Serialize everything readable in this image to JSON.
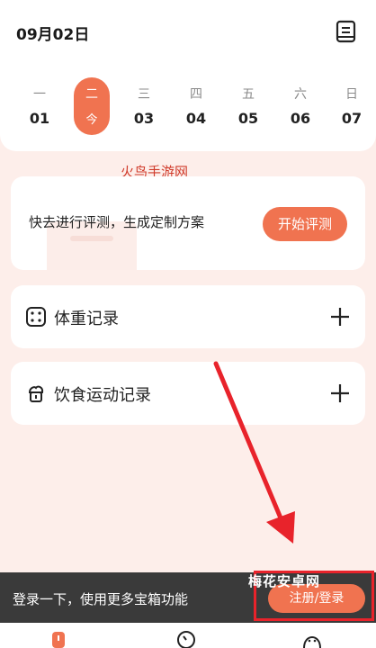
{
  "header": {
    "date": "09月02日",
    "calendar_icon": "calendar-book-icon"
  },
  "week": [
    {
      "name": "一",
      "num": "01",
      "selected": false
    },
    {
      "name": "二",
      "num": "今",
      "selected": true
    },
    {
      "name": "三",
      "num": "03",
      "selected": false
    },
    {
      "name": "四",
      "num": "04",
      "selected": false
    },
    {
      "name": "五",
      "num": "05",
      "selected": false
    },
    {
      "name": "六",
      "num": "06",
      "selected": false
    },
    {
      "name": "日",
      "num": "07",
      "selected": false
    }
  ],
  "watermark_top": "火鸟手游网",
  "evaluation": {
    "text": "快去进行评测，生成定制方案",
    "button": "开始评测"
  },
  "records": [
    {
      "label": "体重记录",
      "icon": "scale-icon"
    },
    {
      "label": "饮食运动记录",
      "icon": "food-icon"
    }
  ],
  "login_bar": {
    "text": "登录一下，使用更多宝箱功能",
    "button": "注册/登录",
    "watermark": "梅花安卓网"
  },
  "colors": {
    "accent": "#f07350",
    "background": "#fdeeea",
    "annotation": "#e8232b",
    "bar": "#3a3a3a"
  }
}
